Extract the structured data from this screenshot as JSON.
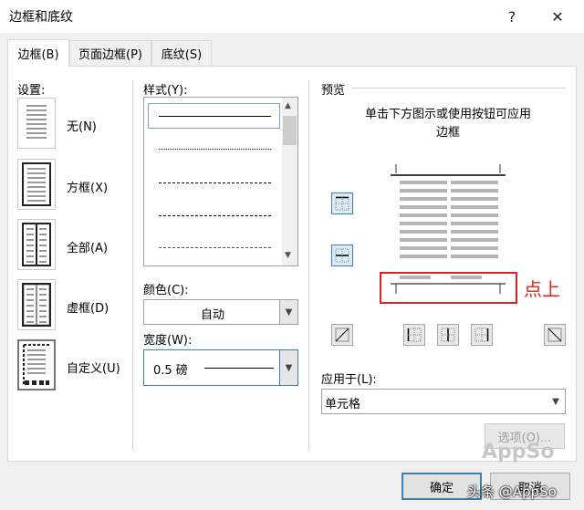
{
  "window": {
    "title": "边框和底纹",
    "help": "?",
    "close": "✕"
  },
  "tabs": [
    {
      "label": "边框(B)"
    },
    {
      "label": "页面边框(P)"
    },
    {
      "label": "底纹(S)"
    }
  ],
  "settings": {
    "label": "设置:",
    "items": [
      {
        "label": "无(N)"
      },
      {
        "label": "方框(X)"
      },
      {
        "label": "全部(A)"
      },
      {
        "label": "虚框(D)"
      },
      {
        "label": "自定义(U)"
      }
    ]
  },
  "style": {
    "label": "样式(Y):"
  },
  "color": {
    "label": "颜色(C):",
    "value": "自动"
  },
  "width": {
    "label": "宽度(W):",
    "value": "0.5 磅"
  },
  "preview": {
    "label": "预览",
    "hint": "单击下方图示或使用按钮可应用边框",
    "annotation": "点上"
  },
  "apply_to": {
    "label": "应用于(L):",
    "value": "单元格"
  },
  "buttons": {
    "options": "选项(O)...",
    "ok": "确定",
    "cancel": "取消"
  },
  "watermark": {
    "text1": "AppSo",
    "text2": "头条 @AppSo"
  }
}
